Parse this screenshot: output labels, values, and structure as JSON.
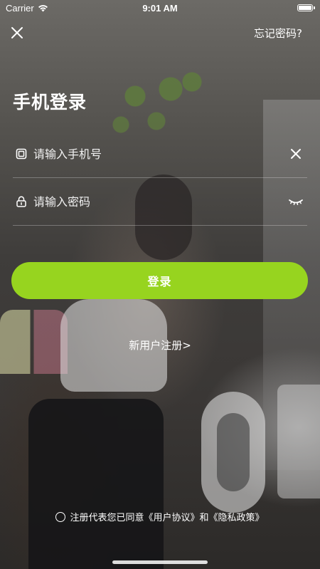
{
  "status_bar": {
    "carrier": "Carrier",
    "time": "9:01 AM",
    "battery_level": 1.0
  },
  "nav": {
    "close_icon": "close-icon",
    "forgot_password": "忘记密码?"
  },
  "title": "手机登录",
  "phone_field": {
    "placeholder": "请输入手机号",
    "value": "",
    "icon": "phone-icon",
    "action_icon": "clear-icon"
  },
  "password_field": {
    "placeholder": "请输入密码",
    "value": "",
    "icon": "lock-icon",
    "action_icon": "eye-closed-icon"
  },
  "login_button": "登录",
  "register_link": "新用户注册>",
  "agreement": {
    "prefix": "注册代表您已同意",
    "user_agreement": "《用户协议》",
    "and": "和",
    "privacy_policy": "《隐私政策》",
    "checked": false
  },
  "colors": {
    "accent": "#97d41f",
    "text": "#ffffff"
  }
}
